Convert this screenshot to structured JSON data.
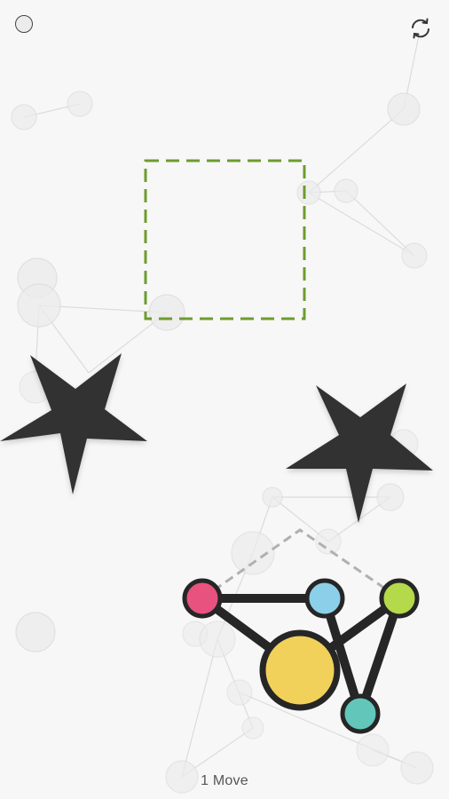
{
  "hud": {
    "move_count": "1",
    "move_label": "Move"
  },
  "icons": {
    "menu": "circle-icon",
    "restart": "refresh-icon"
  },
  "colors": {
    "background": "#f7f7f7",
    "target_outline": "#6d9c2e",
    "obstacle": "#333333",
    "edge": "#262626",
    "ghost_edge": "#b0b0b0",
    "node_pink": "#e8527f",
    "node_blue": "#8ccfe9",
    "node_lime": "#b4d94a",
    "node_yellow": "#f1d15a",
    "node_teal": "#62c6bb"
  },
  "puzzle": {
    "nodes": [
      {
        "id": "pink",
        "color": "#e8527f"
      },
      {
        "id": "blue",
        "color": "#8ccfe9"
      },
      {
        "id": "lime",
        "color": "#b4d94a"
      },
      {
        "id": "yellow",
        "color": "#f1d15a"
      },
      {
        "id": "teal",
        "color": "#62c6bb"
      }
    ],
    "edges": [
      [
        "pink",
        "blue"
      ],
      [
        "pink",
        "yellow"
      ],
      [
        "blue",
        "teal"
      ],
      [
        "lime",
        "yellow"
      ],
      [
        "lime",
        "teal"
      ]
    ],
    "obstacles": [
      "star",
      "star"
    ],
    "target": "square"
  }
}
